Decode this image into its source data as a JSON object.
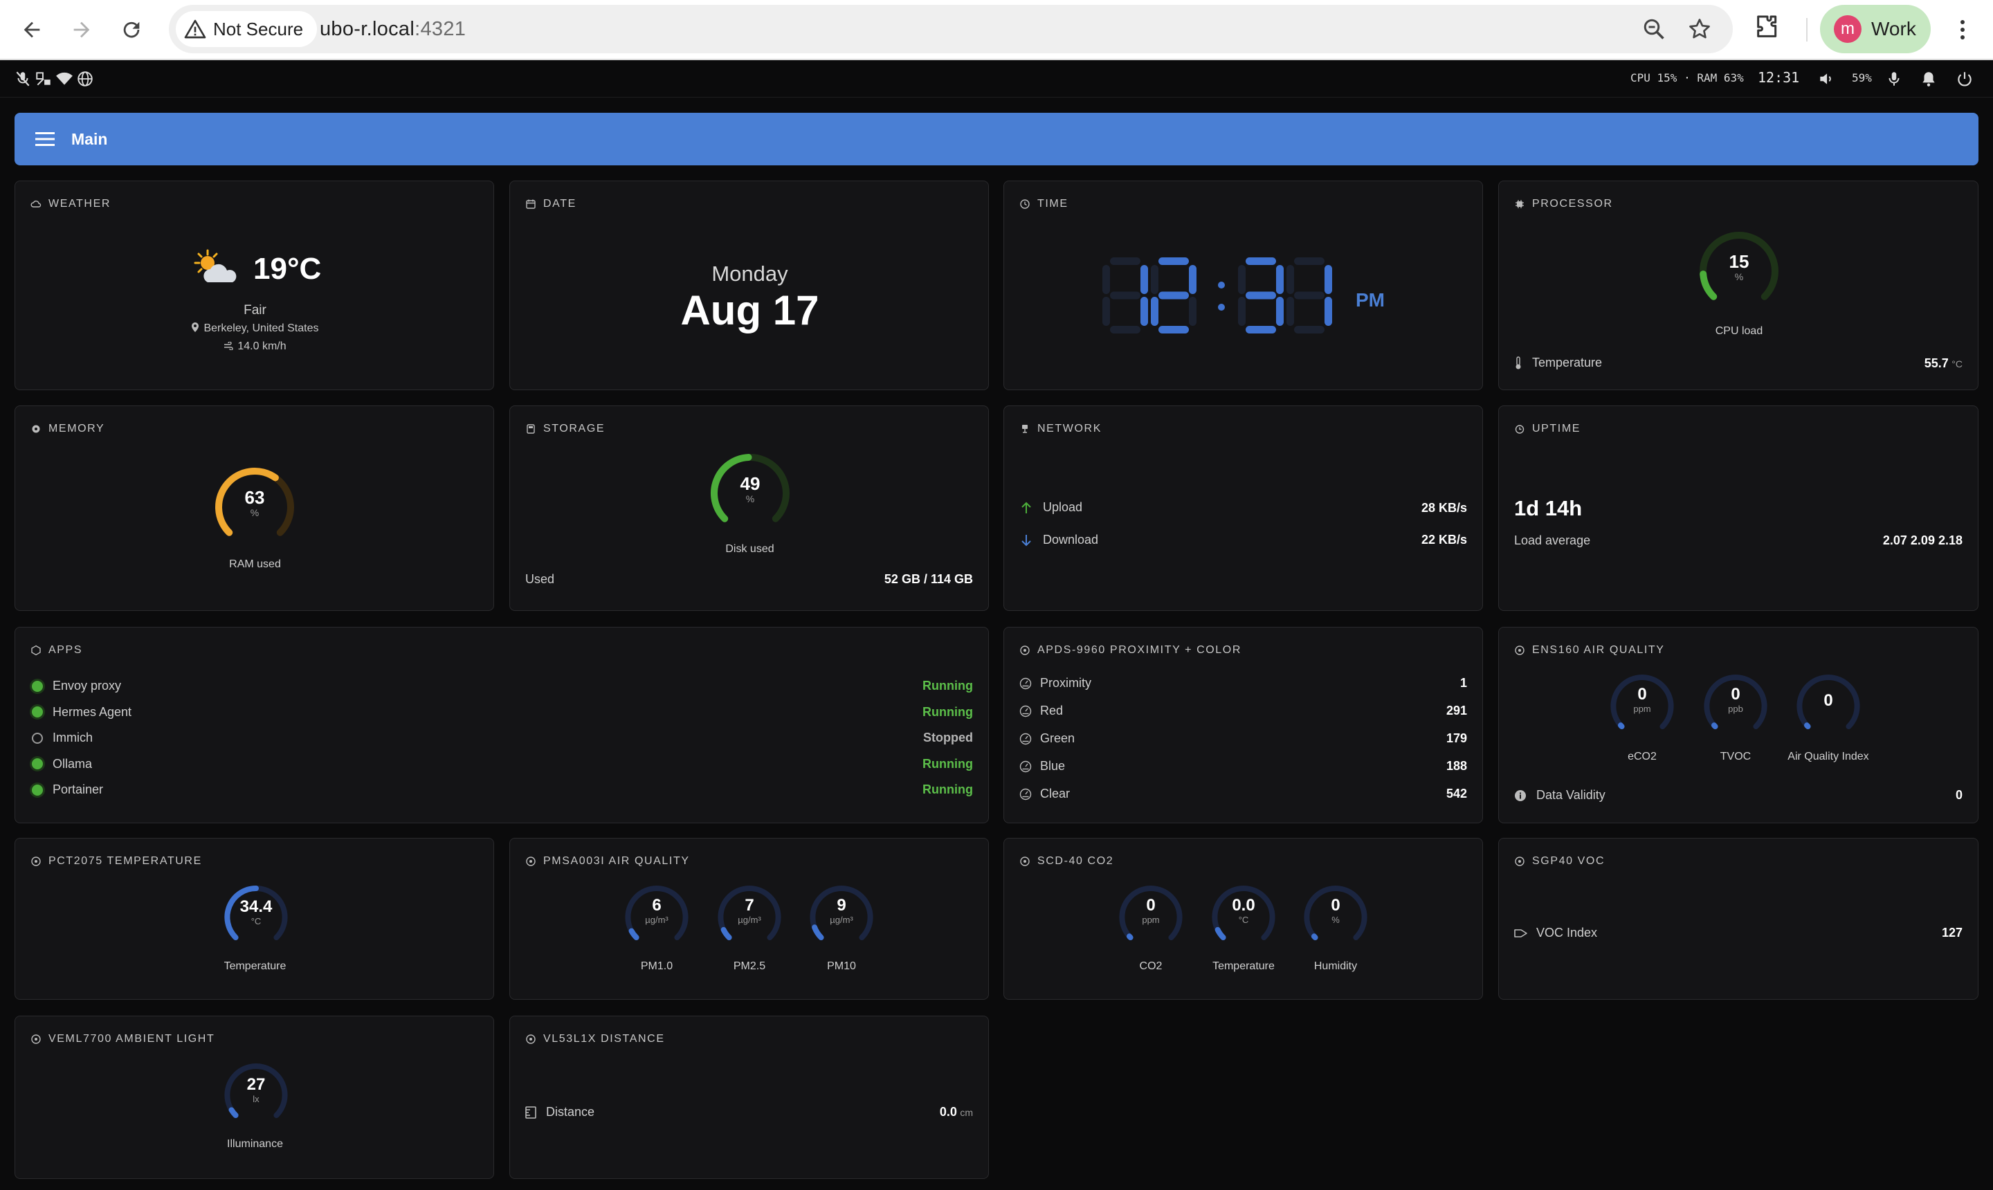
{
  "browser": {
    "security_label": "Not Secure",
    "url_host": "ubo-r.local",
    "url_port": ":4321",
    "profile_initial": "m",
    "profile_name": "Work"
  },
  "status_bar": {
    "metrics": "CPU 15% · RAM 63%",
    "clock": "12:31",
    "battery": "59%"
  },
  "app_bar": {
    "title": "Main"
  },
  "weather": {
    "header": "WEATHER",
    "temp": "19°C",
    "condition": "Fair",
    "location": "Berkeley, United States",
    "wind": "14.0 km/h"
  },
  "date": {
    "header": "DATE",
    "weekday": "Monday",
    "day": "Aug 17"
  },
  "time": {
    "header": "TIME",
    "hours": "12",
    "minutes": "31",
    "ampm": "PM"
  },
  "processor": {
    "header": "PROCESSOR",
    "cpu_value": "15",
    "cpu_unit": "%",
    "cpu_fraction": 0.15,
    "cpu_caption": "CPU load",
    "temp_label": "Temperature",
    "temp_value": "55.7",
    "temp_unit": "°C"
  },
  "memory": {
    "header": "MEMORY",
    "value": "63",
    "unit": "%",
    "fraction": 0.63,
    "caption": "RAM used"
  },
  "storage": {
    "header": "STORAGE",
    "value": "49",
    "unit": "%",
    "fraction": 0.49,
    "caption": "Disk used",
    "used_label": "Used",
    "used_value": "52 GB / 114 GB"
  },
  "network": {
    "header": "NETWORK",
    "upload_label": "Upload",
    "upload_value": "28 KB/s",
    "download_label": "Download",
    "download_value": "22 KB/s"
  },
  "uptime": {
    "header": "UPTIME",
    "value": "1d 14h",
    "load_label": "Load average",
    "load_value": "2.07 2.09 2.18"
  },
  "apps": {
    "header": "APPS",
    "items": [
      {
        "name": "Envoy proxy",
        "status": "Running",
        "running": true
      },
      {
        "name": "Hermes Agent",
        "status": "Running",
        "running": true
      },
      {
        "name": "Immich",
        "status": "Stopped",
        "running": false
      },
      {
        "name": "Ollama",
        "status": "Running",
        "running": true
      },
      {
        "name": "Portainer",
        "status": "Running",
        "running": true
      }
    ]
  },
  "apds": {
    "header": "APDS-9960 PROXIMITY + COLOR",
    "rows": [
      {
        "label": "Proximity",
        "value": "1"
      },
      {
        "label": "Red",
        "value": "291"
      },
      {
        "label": "Green",
        "value": "179"
      },
      {
        "label": "Blue",
        "value": "188"
      },
      {
        "label": "Clear",
        "value": "542"
      }
    ]
  },
  "ens160": {
    "header": "ENS160 AIR QUALITY",
    "gauges": [
      {
        "value": "0",
        "unit": "ppm",
        "caption": "eCO2",
        "fraction": 0
      },
      {
        "value": "0",
        "unit": "ppb",
        "caption": "TVOC",
        "fraction": 0
      },
      {
        "value": "0",
        "unit": "",
        "caption": "Air Quality Index",
        "fraction": 0
      }
    ],
    "validity_label": "Data Validity",
    "validity_value": "0"
  },
  "pct2075": {
    "header": "PCT2075 TEMPERATURE",
    "value": "34.4",
    "unit": "°C",
    "fraction": 0.5,
    "caption": "Temperature"
  },
  "pmsa": {
    "header": "PMSA003I AIR QUALITY",
    "gauges": [
      {
        "value": "6",
        "unit": "µg/m³",
        "caption": "PM1.0",
        "fraction": 0.06
      },
      {
        "value": "7",
        "unit": "µg/m³",
        "caption": "PM2.5",
        "fraction": 0.07
      },
      {
        "value": "9",
        "unit": "µg/m³",
        "caption": "PM10",
        "fraction": 0.09
      }
    ]
  },
  "scd40": {
    "header": "SCD-40 CO2",
    "gauges": [
      {
        "value": "0",
        "unit": "ppm",
        "caption": "CO2",
        "fraction": 0
      },
      {
        "value": "0.0",
        "unit": "°C",
        "caption": "Temperature",
        "fraction": 0.07
      },
      {
        "value": "0",
        "unit": "%",
        "caption": "Humidity",
        "fraction": 0
      }
    ]
  },
  "sgp40": {
    "header": "SGP40 VOC",
    "label": "VOC Index",
    "value": "127"
  },
  "veml": {
    "header": "VEML7700 AMBIENT LIGHT",
    "value": "27",
    "unit": "lx",
    "fraction": 0.05,
    "caption": "Illuminance"
  },
  "vl53": {
    "header": "VL53L1X DISTANCE",
    "label": "Distance",
    "value": "0.0",
    "unit": "cm"
  },
  "colors": {
    "accent": "#4a7fd4",
    "green": "#4cae3a",
    "amber": "#f0a830",
    "blue_gauge": "#3f72d0"
  }
}
